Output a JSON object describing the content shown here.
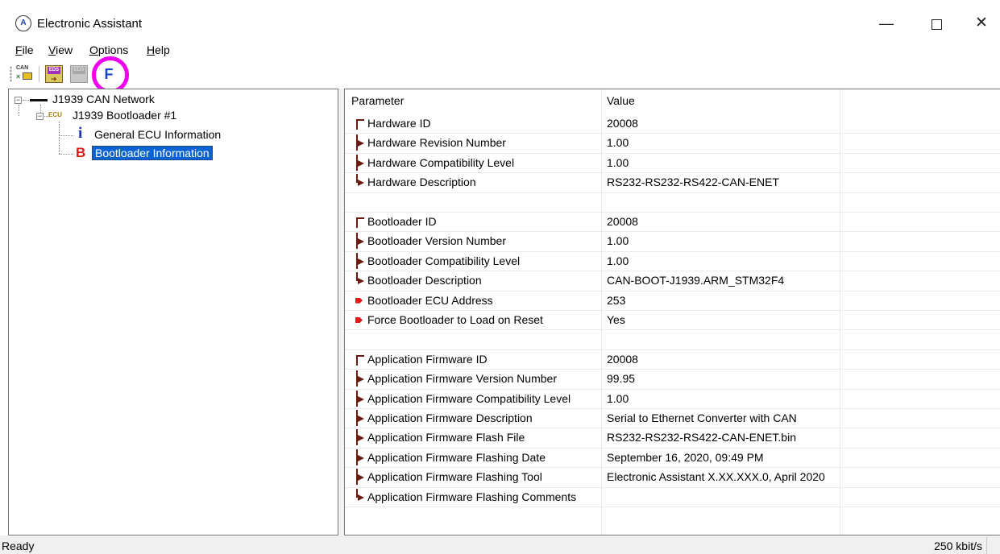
{
  "window": {
    "title": "Electronic Assistant",
    "icon_glyph": "A",
    "min_glyph": "—",
    "close_glyph": "✕"
  },
  "menu": [
    "File",
    "View",
    "Options",
    "Help"
  ],
  "menu_underline": [
    "F",
    "V",
    "O",
    "H"
  ],
  "menu_rest": [
    "ile",
    "iew",
    "ptions",
    "elp"
  ],
  "toolbar": {
    "can_label": "CAN",
    "save_label": "EDS",
    "load_label": "EDS",
    "flash_label": "F",
    "highlight_color": "#f000f0"
  },
  "tree": {
    "network": "J1939 CAN Network",
    "ecu_tag": "ECU",
    "ecu": "J1939 Bootloader #1",
    "info_glyph": "i",
    "general": "General ECU Information",
    "b_glyph": "B",
    "bootloader": "Bootloader Information"
  },
  "grid": {
    "headers": [
      "Parameter",
      "Value"
    ],
    "rows": [
      {
        "marker": "top",
        "param": "Hardware ID",
        "value": "20008"
      },
      {
        "marker": "mid",
        "param": "Hardware Revision Number",
        "value": "1.00"
      },
      {
        "marker": "mid",
        "param": "Hardware Compatibility Level",
        "value": "1.00"
      },
      {
        "marker": "end",
        "param": "Hardware Description",
        "value": "RS232-RS232-RS422-CAN-ENET"
      },
      {
        "marker": "",
        "param": "",
        "value": ""
      },
      {
        "marker": "top",
        "param": "Bootloader ID",
        "value": "20008"
      },
      {
        "marker": "mid",
        "param": "Bootloader Version Number",
        "value": "1.00"
      },
      {
        "marker": "mid",
        "param": "Bootloader Compatibility Level",
        "value": "1.00"
      },
      {
        "marker": "end",
        "param": "Bootloader Description",
        "value": "CAN-BOOT-J1939.ARM_STM32F4"
      },
      {
        "marker": "red",
        "param": "Bootloader ECU Address",
        "value": "253"
      },
      {
        "marker": "red",
        "param": "Force Bootloader to Load on Reset",
        "value": "Yes"
      },
      {
        "marker": "",
        "param": "",
        "value": ""
      },
      {
        "marker": "top",
        "param": "Application Firmware ID",
        "value": "20008"
      },
      {
        "marker": "mid",
        "param": "Application Firmware Version Number",
        "value": "99.95"
      },
      {
        "marker": "mid",
        "param": "Application Firmware Compatibility Level",
        "value": "1.00"
      },
      {
        "marker": "mid",
        "param": "Application Firmware Description",
        "value": "Serial to Ethernet Converter with CAN"
      },
      {
        "marker": "mid",
        "param": "Application Firmware Flash File",
        "value": "RS232-RS232-RS422-CAN-ENET.bin"
      },
      {
        "marker": "mid",
        "param": "Application Firmware Flashing Date",
        "value": "September 16, 2020, 09:49 PM"
      },
      {
        "marker": "mid",
        "param": "Application Firmware Flashing Tool",
        "value": "Electronic Assistant X.XX.XXX.0, April 2020"
      },
      {
        "marker": "end",
        "param": "Application Firmware Flashing Comments",
        "value": ""
      }
    ]
  },
  "status": {
    "text": "Ready",
    "bitrate": "250 kbit/s"
  }
}
